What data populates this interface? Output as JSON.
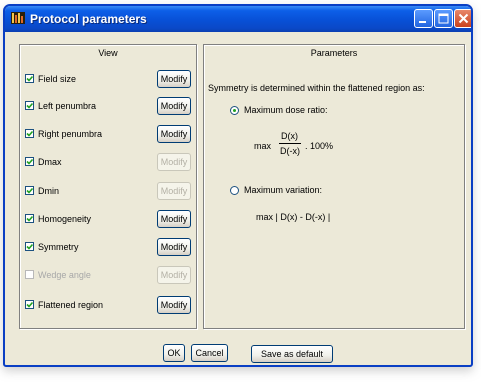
{
  "window": {
    "title": "Protocol parameters"
  },
  "view_panel": {
    "title": "View",
    "items": [
      {
        "label": "Field size",
        "checked": true,
        "enabled": true,
        "button": "Modify",
        "button_enabled": true
      },
      {
        "label": "Left penumbra",
        "checked": true,
        "enabled": true,
        "button": "Modify",
        "button_enabled": true
      },
      {
        "label": "Right penumbra",
        "checked": true,
        "enabled": true,
        "button": "Modify",
        "button_enabled": true
      },
      {
        "label": "Dmax",
        "checked": true,
        "enabled": true,
        "button": "Modify",
        "button_enabled": false
      },
      {
        "label": "Dmin",
        "checked": true,
        "enabled": true,
        "button": "Modify",
        "button_enabled": false
      },
      {
        "label": "Homogeneity",
        "checked": true,
        "enabled": true,
        "button": "Modify",
        "button_enabled": true
      },
      {
        "label": "Symmetry",
        "checked": true,
        "enabled": true,
        "button": "Modify",
        "button_enabled": true
      },
      {
        "label": "Wedge angle",
        "checked": false,
        "enabled": false,
        "button": "Modify",
        "button_enabled": false
      },
      {
        "label": "Flattened region",
        "checked": true,
        "enabled": true,
        "button": "Modify",
        "button_enabled": true
      }
    ]
  },
  "params_panel": {
    "title": "Parameters",
    "description": "Symmetry is determined within the flattened region as:",
    "option_max_ratio": {
      "label": "Maximum dose ratio:",
      "selected": true
    },
    "formula_ratio": {
      "prefix": "max",
      "numerator": "D(x)",
      "denominator": "D(-x)",
      "suffix": ". 100%"
    },
    "option_max_variation": {
      "label": "Maximum variation:",
      "selected": false
    },
    "formula_variation": "max | D(x) - D(-x) |"
  },
  "footer": {
    "ok": "OK",
    "cancel": "Cancel",
    "save_default": "Save as default"
  },
  "colors": {
    "titlebar": "#0a49c8",
    "dialog_bg": "#ece9d8",
    "check": "#21a121"
  }
}
